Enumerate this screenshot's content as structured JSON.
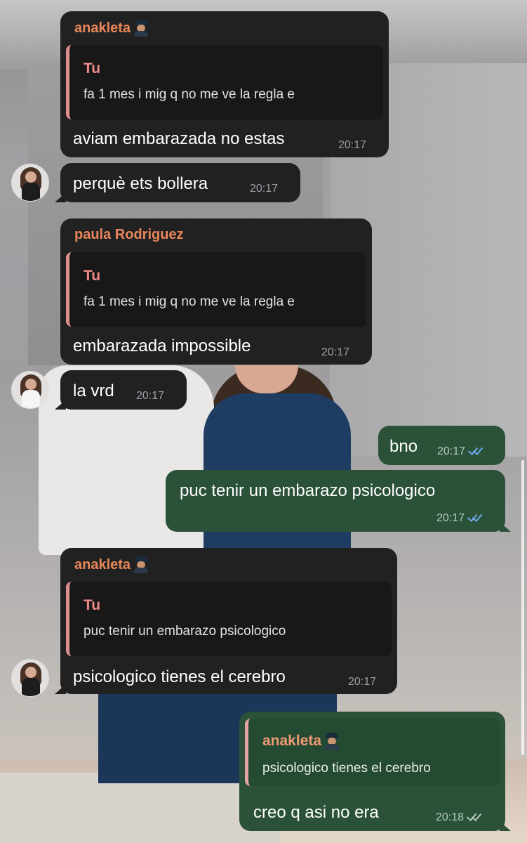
{
  "messages": [
    {
      "sender": "anakleta",
      "sender_emoji": "pilot-emoji",
      "reply": {
        "name": "Tu",
        "text": "fa 1 mes i mig q no me ve la regla e"
      },
      "text": "aviam embarazada no estas",
      "time": "20:17"
    },
    {
      "text": "perquè ets bollera",
      "time": "20:17"
    },
    {
      "sender": "paula Rodriguez",
      "reply": {
        "name": "Tu",
        "text": "fa 1 mes i mig q no me ve la regla e"
      },
      "text": "embarazada impossible",
      "time": "20:17"
    },
    {
      "text": "la vrd",
      "time": "20:17"
    },
    {
      "text": "bno",
      "time": "20:17",
      "status": "read"
    },
    {
      "text": "puc tenir un embarazo psicologico",
      "time": "20:17",
      "status": "read"
    },
    {
      "sender": "anakleta",
      "sender_emoji": "pilot-emoji",
      "reply": {
        "name": "Tu",
        "text": "puc tenir un embarazo psicologico"
      },
      "text": "psicologico tienes el cerebro",
      "time": "20:17"
    },
    {
      "reply": {
        "name": "anakleta",
        "name_emoji": "pilot-emoji",
        "text": "psicologico tienes el cerebro"
      },
      "text": "creo q asi no era",
      "time": "20:18",
      "status": "delivered"
    }
  ],
  "colors": {
    "incoming_bubble": "#212121",
    "outgoing_bubble": "#2b5239",
    "sender_name": "#e9875b",
    "reply_accent": "#e08f8f",
    "read_check": "#6ea8e8"
  }
}
